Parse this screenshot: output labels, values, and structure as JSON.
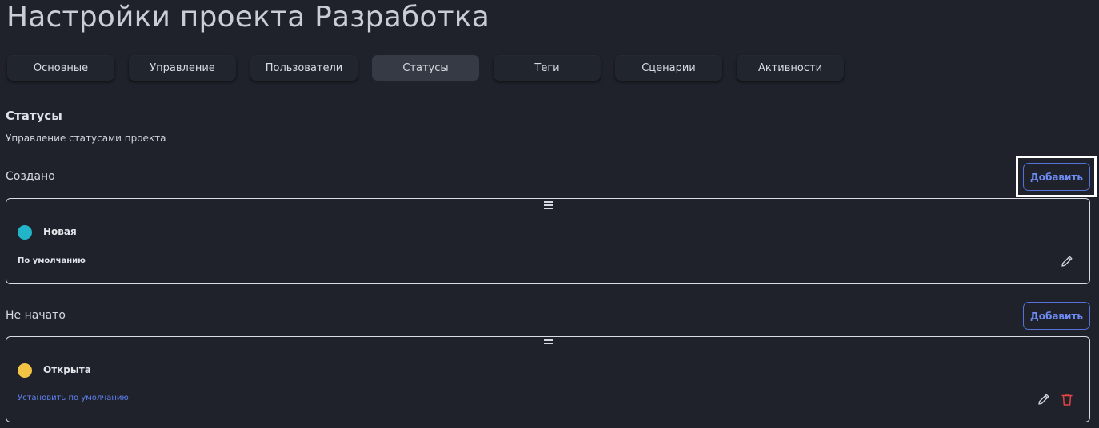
{
  "page": {
    "title": "Настройки проекта Разработка"
  },
  "tabs": [
    {
      "label": "Основные",
      "active": false
    },
    {
      "label": "Управление",
      "active": false
    },
    {
      "label": "Пользователи",
      "active": false
    },
    {
      "label": "Статусы",
      "active": true
    },
    {
      "label": "Теги",
      "active": false
    },
    {
      "label": "Сценарии",
      "active": false
    },
    {
      "label": "Активности",
      "active": false
    }
  ],
  "section": {
    "title": "Статусы",
    "subtitle": "Управление статусами проекта"
  },
  "groups": [
    {
      "label": "Создано",
      "add_label": "Добавить",
      "status": {
        "name": "Новая",
        "color": "#22b5c9",
        "default_text": "По умолчанию"
      }
    },
    {
      "label": "Не начато",
      "add_label": "Добавить",
      "status": {
        "name": "Открыта",
        "color": "#f3c443",
        "set_default_text": "Установить по умолчанию"
      }
    }
  ],
  "icons": {
    "drag": "drag-handle-icon",
    "edit": "pencil-icon",
    "delete": "trash-icon"
  },
  "colors": {
    "background": "#1f222a",
    "accent": "#6d8cf5",
    "danger": "#e04444"
  }
}
